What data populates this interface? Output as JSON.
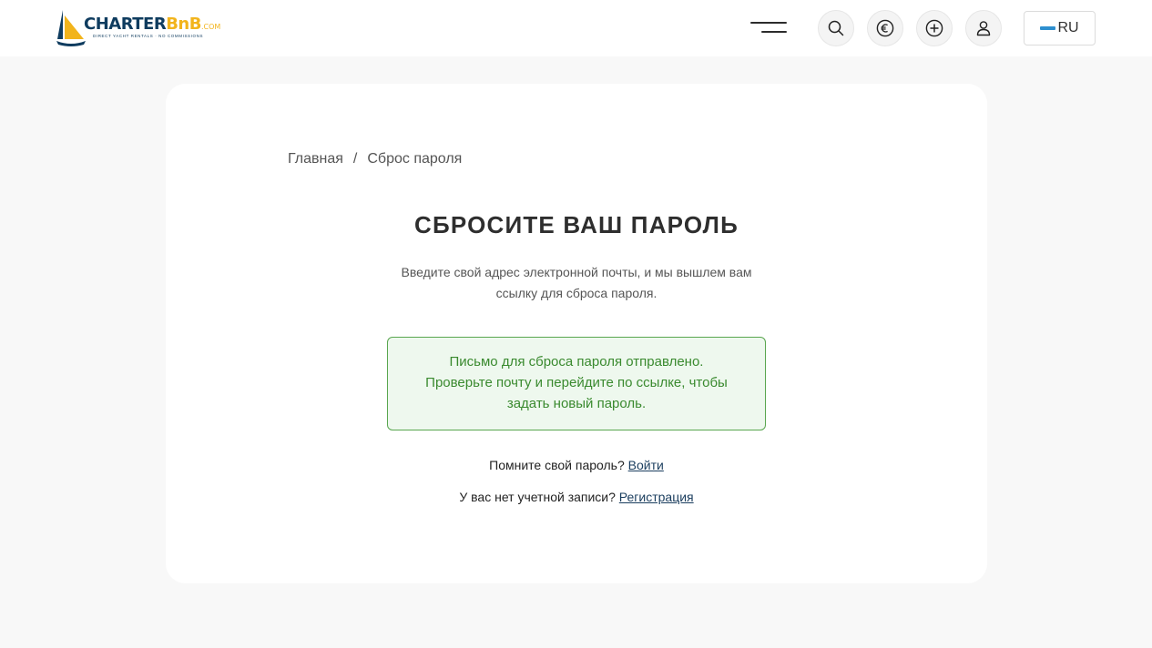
{
  "header": {
    "logo": {
      "text_main": "CHARTER",
      "text_accent": "BnB",
      "text_suffix": ".COM",
      "tagline": "DIRECT YACHT RENTALS · NO COMMISSIONS"
    },
    "icons": {
      "menu": "hamburger-menu-icon",
      "search": "search-icon",
      "currency": "euro-icon",
      "add": "plus-circle-icon",
      "account": "user-icon"
    },
    "language": "RU"
  },
  "breadcrumb": {
    "home": "Главная",
    "separator": "/",
    "current": "Сброс пароля"
  },
  "main": {
    "title": "СБРОСИТЕ ВАШ ПАРОЛЬ",
    "description": "Введите свой адрес электронной почты, и мы вышлем вам ссылку для сброса пароля.",
    "alert_lines": [
      "Письмо для сброса пароля отправлено.",
      "Проверьте почту и перейдите по ссылке, чтобы",
      "задать новый пароль."
    ],
    "remember_text": "Помните свой пароль?",
    "login_link": "Войти",
    "no_account_text": "У вас нет учетной записи?",
    "register_link": "Регистрация"
  },
  "colors": {
    "page_background": "#f8f8f8",
    "alert_text": "#3a8a2f",
    "alert_border": "#59a64f",
    "alert_background": "#eef8ee",
    "brand_navy": "#0f3c5f",
    "brand_yellow": "#f2b41c",
    "flag_blue": "#2e8fcf"
  }
}
